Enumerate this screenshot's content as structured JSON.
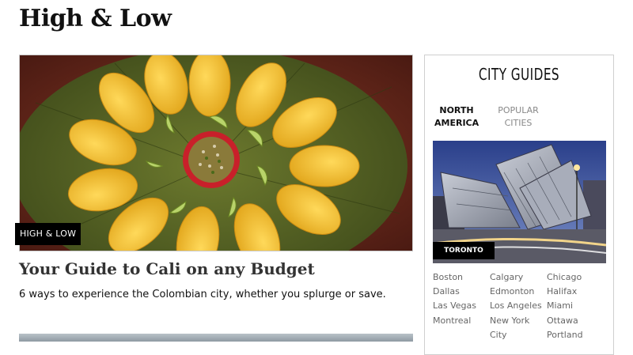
{
  "page": {
    "title": "High & Low"
  },
  "article": {
    "category": "HIGH & LOW",
    "title": "Your Guide to Cali on any Budget",
    "description": "6 ways to experience the Colombian city, whether you splurge or save."
  },
  "city_guides": {
    "title": "CITY GUIDES",
    "tabs": [
      {
        "label_line1": "NORTH",
        "label_line2": "AMERICA",
        "active": true
      },
      {
        "label_line1": "POPULAR",
        "label_line2": "CITIES",
        "active": false
      }
    ],
    "featured_city": "TORONTO",
    "columns": [
      [
        "Boston",
        "Dallas",
        "Las Vegas",
        "Montreal"
      ],
      [
        "Calgary",
        "Edmonton",
        "Los Angeles",
        "New York City"
      ],
      [
        "Chicago",
        "Halifax",
        "Miami",
        "Ottawa",
        "Portland"
      ]
    ]
  }
}
